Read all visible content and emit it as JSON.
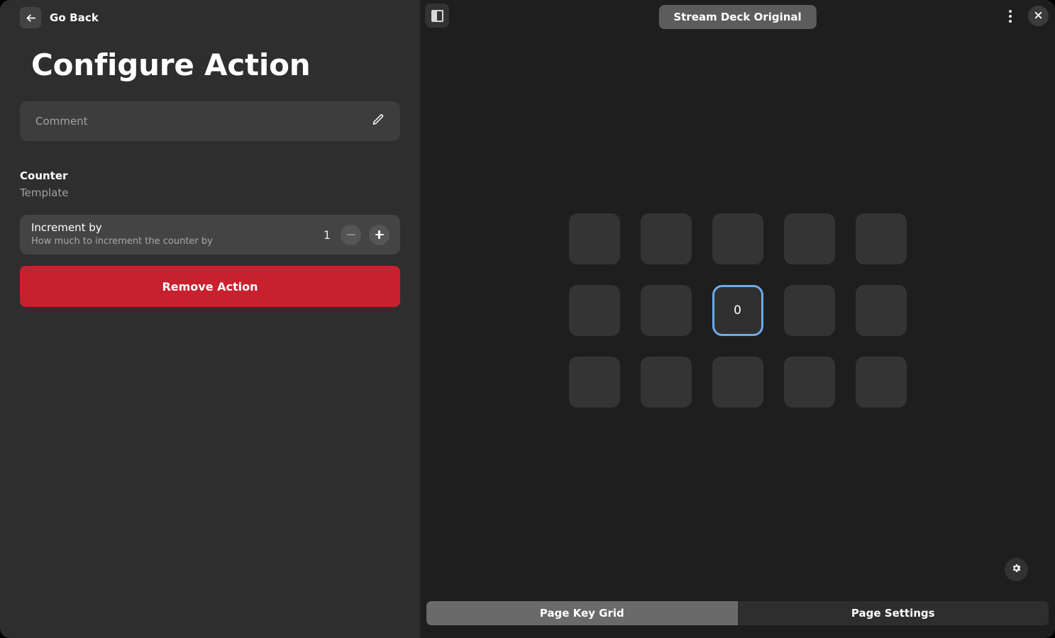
{
  "window": {
    "accent_blue": "#6cabe8",
    "danger_red": "#c8202e",
    "left_bg": "#2e2e2e",
    "right_bg": "#1e1e1e"
  },
  "left": {
    "go_back": {
      "label": "Go Back",
      "icon": "arrow-left-icon"
    },
    "title": "Configure Action",
    "comment": {
      "value": "",
      "placeholder": "Comment",
      "edit_icon": "pencil-icon"
    },
    "action": {
      "name": "Counter",
      "type": "Template"
    },
    "settings": [
      {
        "label": "Increment by",
        "description": "How much to increment the counter by",
        "value": "1",
        "minus_label": "−",
        "plus_label": "+"
      }
    ],
    "remove_button": "Remove Action"
  },
  "right": {
    "topbar": {
      "sidebar_toggle_icon": "sidebar-toggle-icon",
      "device_name": "Stream Deck Original",
      "kebab_icon": "more-vertical-icon",
      "close_icon": "close-icon"
    },
    "grid": {
      "columns": 5,
      "rows": 3,
      "keys": [
        {
          "index": 0,
          "label": "",
          "selected": false
        },
        {
          "index": 1,
          "label": "",
          "selected": false
        },
        {
          "index": 2,
          "label": "",
          "selected": false
        },
        {
          "index": 3,
          "label": "",
          "selected": false
        },
        {
          "index": 4,
          "label": "",
          "selected": false
        },
        {
          "index": 5,
          "label": "",
          "selected": false
        },
        {
          "index": 6,
          "label": "",
          "selected": false
        },
        {
          "index": 7,
          "label": "0",
          "selected": true
        },
        {
          "index": 8,
          "label": "",
          "selected": false
        },
        {
          "index": 9,
          "label": "",
          "selected": false
        },
        {
          "index": 10,
          "label": "",
          "selected": false
        },
        {
          "index": 11,
          "label": "",
          "selected": false
        },
        {
          "index": 12,
          "label": "",
          "selected": false
        },
        {
          "index": 13,
          "label": "",
          "selected": false
        },
        {
          "index": 14,
          "label": "",
          "selected": false
        }
      ]
    },
    "settings_icon": "gear-icon",
    "tabs": [
      {
        "label": "Page Key Grid",
        "active": true
      },
      {
        "label": "Page Settings",
        "active": false
      }
    ]
  }
}
